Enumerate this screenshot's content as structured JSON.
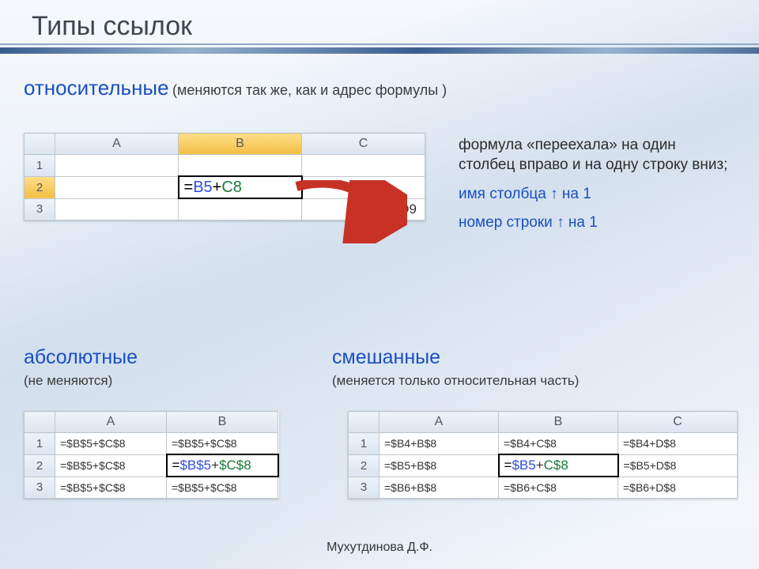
{
  "title": "Типы ссылок",
  "author": "Мухутдинова Д.Ф.",
  "relative": {
    "heading": "относительные",
    "subtitle": "(меняются так же, как и адрес формулы )",
    "cols": [
      "A",
      "B",
      "C"
    ],
    "rows": [
      "1",
      "2",
      "3"
    ],
    "f_eq": "=",
    "f_b": "B5",
    "f_plus": "+",
    "f_c": "C8",
    "below": "=C6+D9",
    "note1": "формула «переехала» на один столбец вправо и на одну строку вниз;",
    "note2": "имя столбца ↑ на 1",
    "note3": "номер строки ↑ на 1"
  },
  "absolute": {
    "heading": "абсолютные",
    "subtitle": "(не меняются)",
    "cols": [
      "A",
      "B"
    ],
    "rows": [
      "1",
      "2",
      "3"
    ],
    "cells": {
      "r1": [
        "=$B$5+$C$8",
        "=$B$5+$C$8"
      ],
      "r2a": "=$B$5+$C$8",
      "r2b_eq": "=",
      "r2b_b": "$B$5",
      "r2b_plus": "+",
      "r2b_c": "$C$8",
      "r3": [
        "=$B$5+$C$8",
        "=$B$5+$C$8"
      ]
    }
  },
  "mixed": {
    "heading": "смешанные",
    "subtitle": "(меняется только относительная часть)",
    "cols": [
      "A",
      "B",
      "C"
    ],
    "rows": [
      "1",
      "2",
      "3"
    ],
    "cells": {
      "r1": [
        "=$B4+B$8",
        "=$B4+C$8",
        "=$B4+D$8"
      ],
      "r2a": "=$B5+B$8",
      "r2b_eq": "=",
      "r2b_b": "$B5",
      "r2b_plus": "+",
      "r2b_c": "C$8",
      "r2c": "=$B5+D$8",
      "r3": [
        "=$B6+B$8",
        "=$B6+C$8",
        "=$B6+D$8"
      ]
    }
  }
}
